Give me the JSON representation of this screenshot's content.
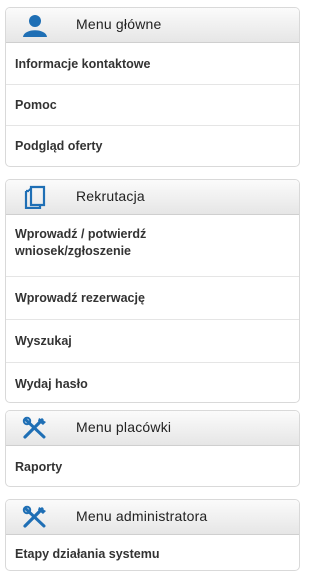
{
  "panels": [
    {
      "title": "Menu główne",
      "icon": "user-icon",
      "items": [
        "Informacje kontaktowe",
        "Pomoc",
        "Podgląd oferty"
      ]
    },
    {
      "title": "Rekrutacja",
      "icon": "document-icon",
      "items": [
        "Wprowadź / potwierdź wniosek/zgłoszenie",
        "Wprowadź rezerwację",
        "Wyszukaj",
        "Wydaj hasło"
      ]
    },
    {
      "title": "Menu placówki",
      "icon": "tools-icon",
      "items": [
        "Raporty"
      ]
    },
    {
      "title": "Menu administratora",
      "icon": "tools-icon",
      "items": [
        "Etapy działania systemu"
      ]
    }
  ],
  "colors": {
    "icon_blue": "#1f6fb5",
    "text": "#333333"
  }
}
